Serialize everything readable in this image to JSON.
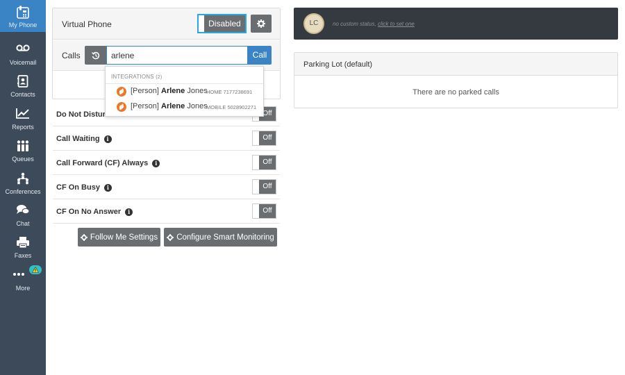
{
  "sidebar": {
    "items": [
      {
        "label": "My Phone",
        "icon": "phone-icon",
        "active": true
      },
      {
        "label": "Voicemail",
        "icon": "voicemail-icon"
      },
      {
        "label": "Contacts",
        "icon": "contacts-icon"
      },
      {
        "label": "Reports",
        "icon": "reports-icon"
      },
      {
        "label": "Queues",
        "icon": "queues-icon"
      },
      {
        "label": "Conferences",
        "icon": "conferences-icon"
      },
      {
        "label": "Chat",
        "icon": "chat-icon"
      },
      {
        "label": "Faxes",
        "icon": "fax-icon"
      },
      {
        "label": "More",
        "icon": "more-icon",
        "badge_icon": "warning-icon"
      }
    ]
  },
  "virtual_phone": {
    "title": "Virtual Phone",
    "status_label": "Disabled",
    "settings_icon": "gear-icon"
  },
  "calls": {
    "label": "Calls",
    "history_icon": "history-icon",
    "search_value": "arlene",
    "call_button": "Call"
  },
  "dropdown": {
    "header": "INTEGRATIONS",
    "count": "(2)",
    "results": [
      {
        "prefix": "[Person]",
        "first": "Arlene",
        "last": "Jones",
        "type": "HOME",
        "number": "7177238691"
      },
      {
        "prefix": "[Person]",
        "first": "Arlene",
        "last": "Jones",
        "type": "MOBILE",
        "number": "5028902271"
      }
    ]
  },
  "settings": [
    {
      "label": "Do Not Disturb",
      "visible_label": "Do Not Disturb",
      "state": "Off",
      "info": false
    },
    {
      "label": "Call Waiting",
      "state": "Off",
      "info": true
    },
    {
      "label": "Call Forward (CF) Always",
      "state": "Off",
      "info": true
    },
    {
      "label": "CF On Busy",
      "state": "Off",
      "info": true
    },
    {
      "label": "CF On No Answer",
      "state": "Off",
      "info": true
    }
  ],
  "actions": {
    "follow_me": "Follow Me Settings",
    "smart_monitoring": "Configure Smart Monitoring"
  },
  "status": {
    "initials": "LC",
    "text": "no custom status,",
    "link": "click to set one"
  },
  "parking_lot": {
    "title": "Parking Lot (default)",
    "empty_message": "There are no parked calls"
  },
  "colors": {
    "sidebar_bg": "#3c4a5a",
    "active_blue": "#3a84c6",
    "focus_outline": "#27a8e0",
    "button_gray": "#6b6e71",
    "integration_orange": "#e8792c",
    "status_bar_bg": "#343a40",
    "warning_badge": "#2ec1c9"
  }
}
